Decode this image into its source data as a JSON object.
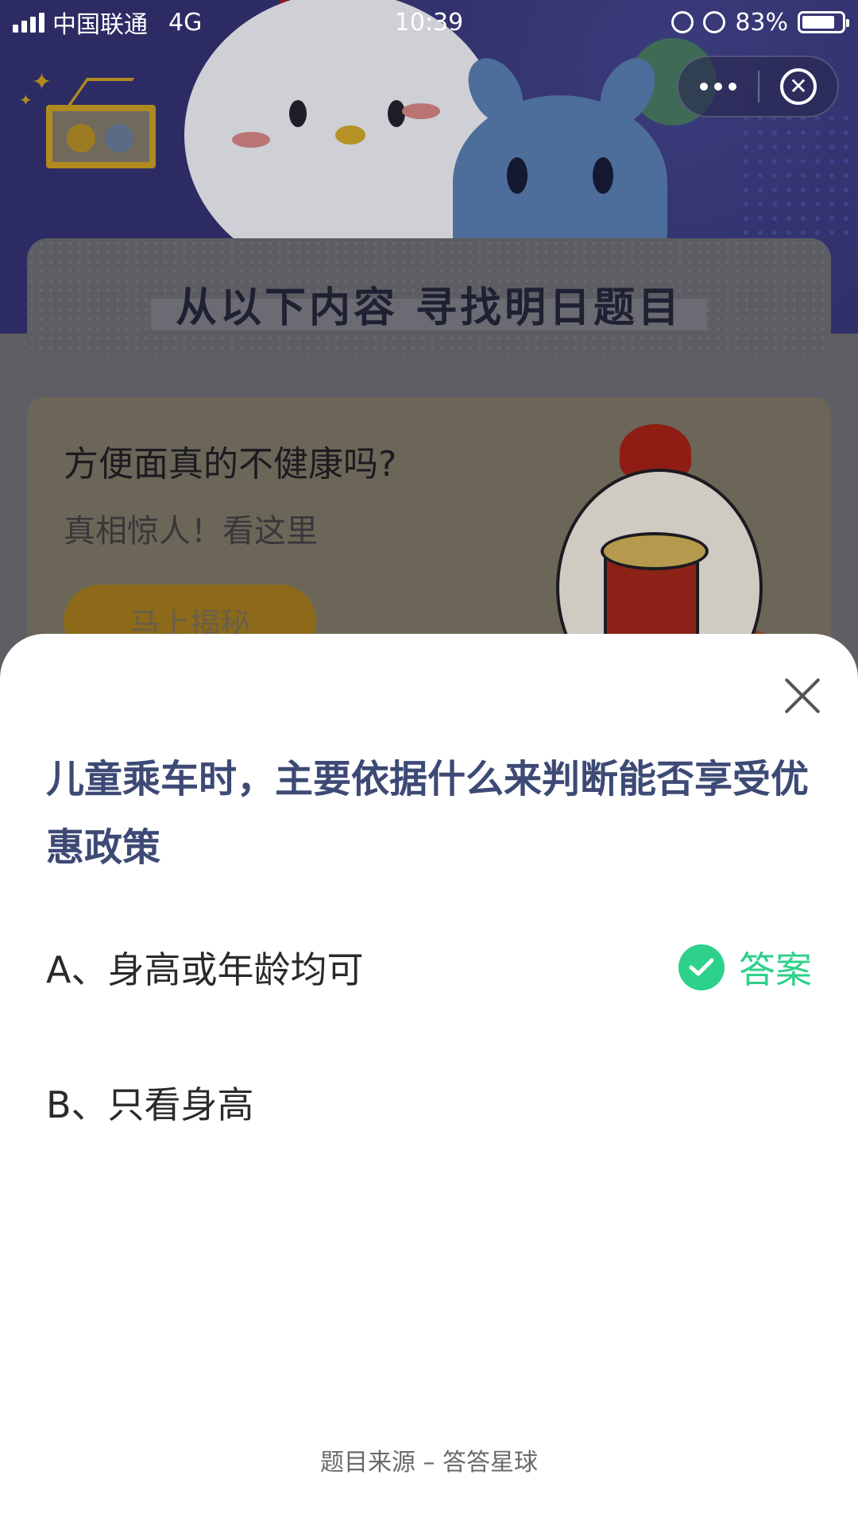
{
  "status_bar": {
    "carrier": "中国联通",
    "network": "4G",
    "time": "10:39",
    "battery": "83%",
    "battery_level": 0.83
  },
  "background_page": {
    "banner_title": "从以下内容  寻找明日题目",
    "promo": {
      "title": "方便面真的不健康吗?",
      "subtitle": "真相惊人！看这里",
      "button_label": "马上揭秘"
    }
  },
  "sheet": {
    "question": "儿童乘车时，主要依据什么来判断能否享受优惠政策",
    "options": [
      {
        "label": "A、身高或年龄均可",
        "is_answer": true
      },
      {
        "label": "B、只看身高",
        "is_answer": false
      }
    ],
    "answer_badge": "答案",
    "source": "题目来源 – 答答星球"
  },
  "colors": {
    "question": "#3d4a75",
    "answer_green": "#2dd18a",
    "overlay_bg": "#2f2e6c"
  },
  "icons": [
    "more-dots-icon",
    "close-circle-icon",
    "close-icon",
    "check-icon",
    "alarm-icon",
    "rotation-lock-icon",
    "battery-icon",
    "signal-icon"
  ]
}
